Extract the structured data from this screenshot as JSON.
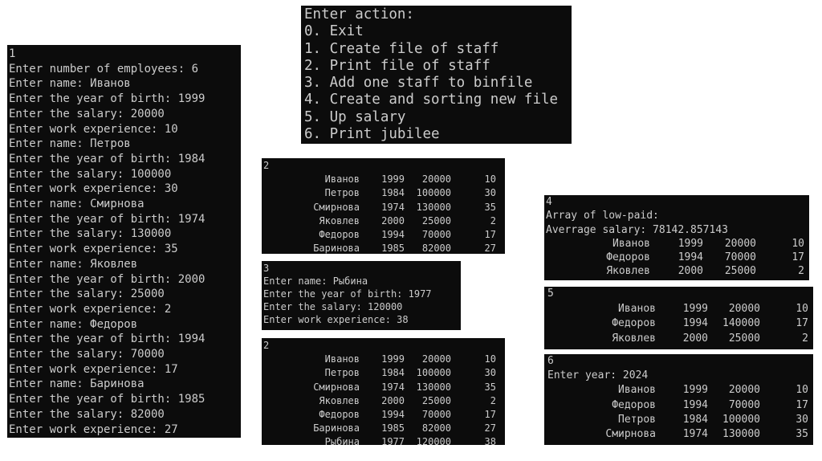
{
  "menu": {
    "lines": [
      "Enter action:",
      "0. Exit",
      "1. Create file of staff",
      "2. Print file of staff",
      "3. Add one staff to binfile",
      "4. Create and sorting new file",
      "5. Up salary",
      "6. Print jubilee"
    ]
  },
  "input_console": {
    "lines": [
      "1",
      "Enter number of employees: 6",
      "Enter name: Иванов",
      "Enter the year of birth: 1999",
      "Enter the salary: 20000",
      "Enter work experience: 10",
      "Enter name: Петров",
      "Enter the year of birth: 1984",
      "Enter the salary: 100000",
      "Enter work experience: 30",
      "Enter name: Смирнова",
      "Enter the year of birth: 1974",
      "Enter the salary: 130000",
      "Enter work experience: 35",
      "Enter name: Яковлев",
      "Enter the year of birth: 2000",
      "Enter the salary: 25000",
      "Enter work experience: 2",
      "Enter name: Федоров",
      "Enter the year of birth: 1994",
      "Enter the salary: 70000",
      "Enter work experience: 17",
      "Enter name: Баринова",
      "Enter the year of birth: 1985",
      "Enter the salary: 82000",
      "Enter work experience: 27"
    ]
  },
  "print1": {
    "header": "2",
    "rows": [
      [
        "Иванов",
        "1999",
        "20000",
        "10"
      ],
      [
        "Петров",
        "1984",
        "100000",
        "30"
      ],
      [
        "Смирнова",
        "1974",
        "130000",
        "35"
      ],
      [
        "Яковлев",
        "2000",
        "25000",
        "2"
      ],
      [
        "Федоров",
        "1994",
        "70000",
        "17"
      ],
      [
        "Баринова",
        "1985",
        "82000",
        "27"
      ]
    ]
  },
  "add": {
    "lines": [
      "3",
      "Enter name: Рыбина",
      "Enter the year of birth: 1977",
      "Enter the salary: 120000",
      "Enter work experience: 38"
    ]
  },
  "print2": {
    "header": "2",
    "rows": [
      [
        "Иванов",
        "1999",
        "20000",
        "10"
      ],
      [
        "Петров",
        "1984",
        "100000",
        "30"
      ],
      [
        "Смирнова",
        "1974",
        "130000",
        "35"
      ],
      [
        "Яковлев",
        "2000",
        "25000",
        "2"
      ],
      [
        "Федоров",
        "1994",
        "70000",
        "17"
      ],
      [
        "Баринова",
        "1985",
        "82000",
        "27"
      ],
      [
        "Рыбина",
        "1977",
        "120000",
        "38"
      ]
    ]
  },
  "low_paid": {
    "lines": [
      "4",
      "Array of low-paid:",
      "Averrage salary: 78142.857143"
    ],
    "rows": [
      [
        "Иванов",
        "1999",
        "20000",
        "10"
      ],
      [
        "Федоров",
        "1994",
        "70000",
        "17"
      ],
      [
        "Яковлев",
        "2000",
        "25000",
        "2"
      ]
    ]
  },
  "up_salary": {
    "header": "5",
    "rows": [
      [
        "Иванов",
        "1999",
        "20000",
        "10"
      ],
      [
        "Федоров",
        "1994",
        "140000",
        "17"
      ],
      [
        "Яковлев",
        "2000",
        "25000",
        "2"
      ]
    ]
  },
  "jubilee": {
    "lines": [
      "6",
      "Enter year: 2024"
    ],
    "rows": [
      [
        "Иванов",
        "1999",
        "20000",
        "10"
      ],
      [
        "Федоров",
        "1994",
        "70000",
        "17"
      ],
      [
        "Петров",
        "1984",
        "100000",
        "30"
      ],
      [
        "Смирнова",
        "1974",
        "130000",
        "35"
      ]
    ]
  },
  "colors": {
    "console_bg": "#0c0c0c",
    "console_text": "#cccccc",
    "page_bg": "#ffffff"
  }
}
